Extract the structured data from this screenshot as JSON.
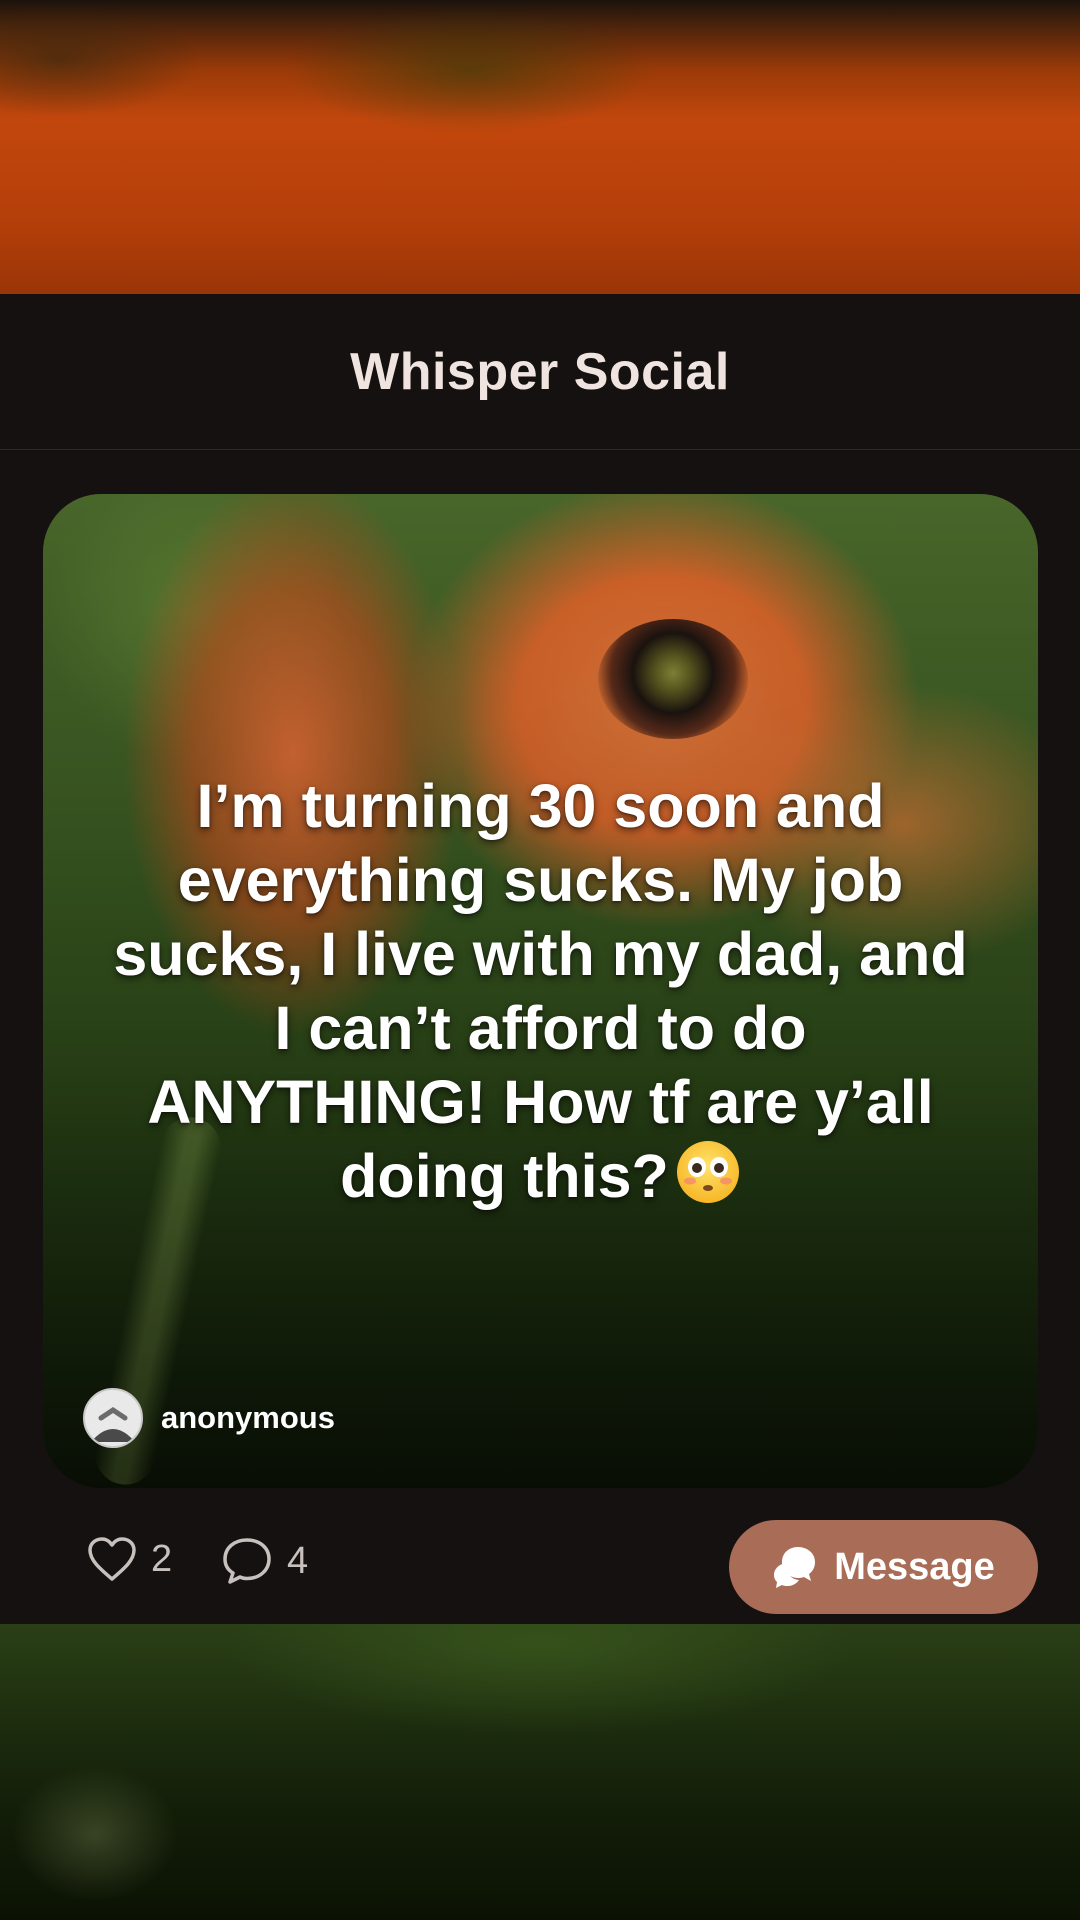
{
  "app": {
    "title": "Whisper Social"
  },
  "post": {
    "text": "I’m turning 30 soon and everything sucks. My job sucks, I live with my dad, and I can’t afford to do ANYTHING! How tf are y’all doing this?",
    "emoji": "flushed-face-emoji",
    "author": "anonymous",
    "author_avatar": "anonymous-avatar-icon",
    "background_image": "red poppy flowers on green field"
  },
  "actions": {
    "likes": "2",
    "comments": "4",
    "message_label": "Message",
    "like_icon": "heart-icon",
    "comment_icon": "comment-icon",
    "message_icon": "chat-bubbles-icon"
  },
  "colors": {
    "background": "#141110",
    "title_text": "#efe4df",
    "message_button": "#a86c57",
    "action_text": "#c8c0bc"
  }
}
